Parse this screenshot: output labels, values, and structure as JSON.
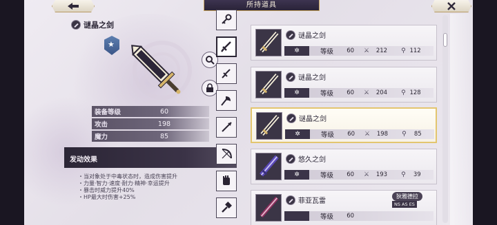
{
  "header": {
    "title": "所持道具",
    "back_icon": "arrow-left",
    "close_icon": "x"
  },
  "detail": {
    "name": "谜晶之剑",
    "stats": [
      {
        "label": "装备等级",
        "value": "60"
      },
      {
        "label": "攻击",
        "value": "198"
      },
      {
        "label": "魔力",
        "value": "85"
      }
    ],
    "effect_title": "发动效果",
    "effects": [
      "・当对象处于中毒状态时，造成伤害提升",
      "・力量·智力·速度·耐力·精神·幸运提升",
      "・暴击时威力提升40%",
      "・HP最大时伤害+25%"
    ]
  },
  "tabs": [
    "key",
    "sword",
    "dagger",
    "axe",
    "spear",
    "bow",
    "glove",
    "hammer"
  ],
  "items": [
    {
      "name": "谜晶之剑",
      "element": "✲",
      "level_label": "等级",
      "level": "60",
      "atk": "212",
      "mag": "112",
      "selected": false
    },
    {
      "name": "谜晶之剑",
      "element": "✲",
      "level_label": "等级",
      "level": "60",
      "atk": "204",
      "mag": "128",
      "selected": false
    },
    {
      "name": "谜晶之剑",
      "element": "✲",
      "level_label": "等级",
      "level": "60",
      "atk": "198",
      "mag": "85",
      "selected": true
    },
    {
      "name": "悠久之剑",
      "element": "✲",
      "level_label": "等级",
      "level": "60",
      "atk": "193",
      "mag": "39",
      "selected": false
    },
    {
      "name": "菲亚瓦雷",
      "element": "",
      "level_label": "等级",
      "level": "60",
      "atk": "",
      "mag": "",
      "selected": false,
      "owner": "狄雅德拉",
      "skills": "NS AS ES"
    }
  ],
  "colors": {
    "accent_gold": "#e3c56e",
    "panel_dark": "#2c2636",
    "title_plate": "#3d3450"
  }
}
